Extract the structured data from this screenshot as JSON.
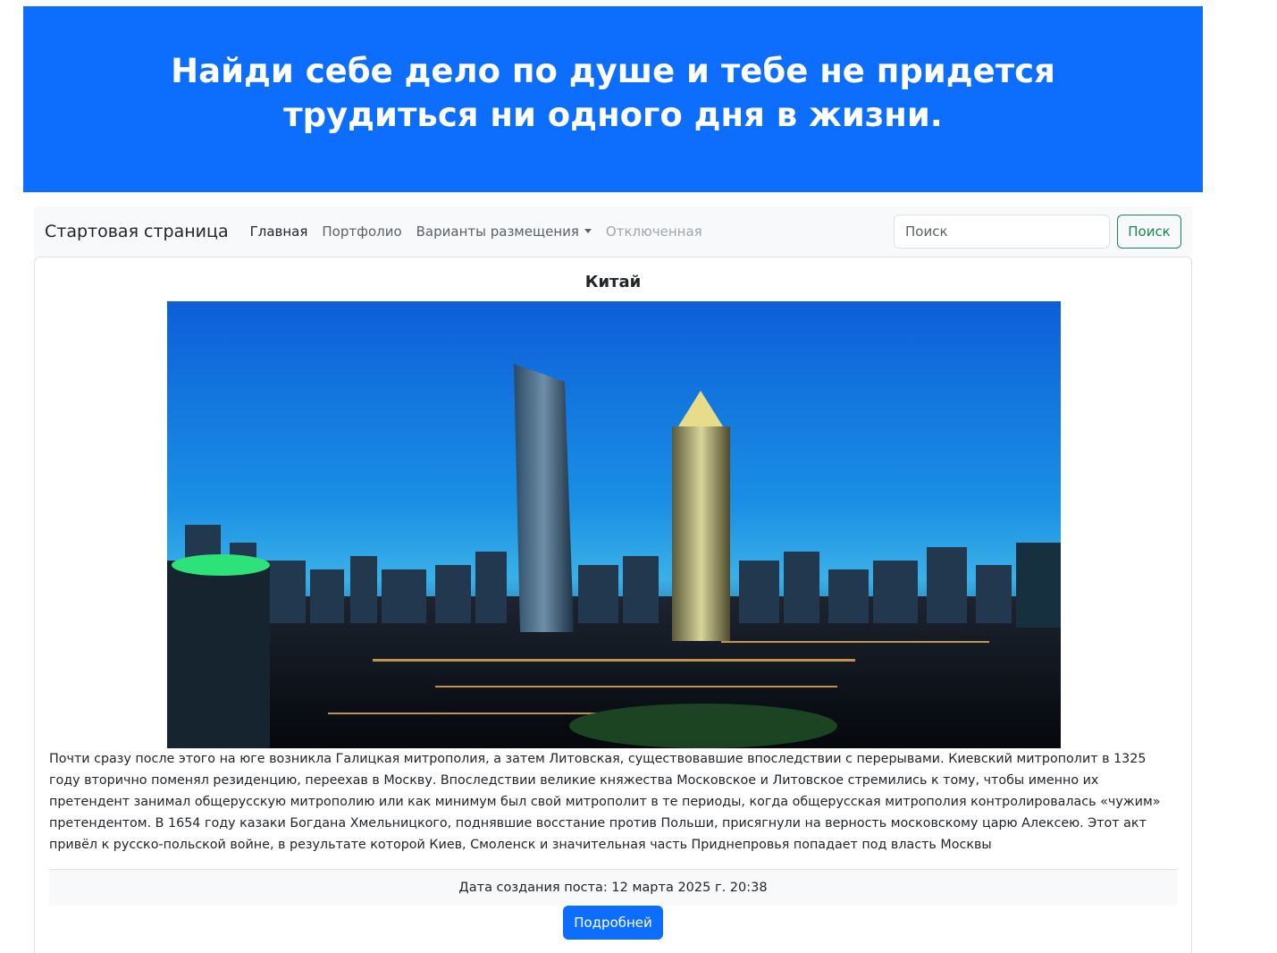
{
  "banner": {
    "title": "Найди себе дело по душе и тебе не придется трудиться ни одного дня в жизни."
  },
  "navbar": {
    "brand": "Стартовая страница",
    "links": [
      {
        "label": "Главная",
        "state": "active"
      },
      {
        "label": "Портфолио",
        "state": "normal"
      },
      {
        "label": "Варианты размещения",
        "state": "dropdown"
      },
      {
        "label": "Отключенная",
        "state": "disabled"
      }
    ],
    "search_placeholder": "Поиск",
    "search_button": "Поиск"
  },
  "post": {
    "title": "Китай",
    "image_alt": "Китай",
    "text": "Почти сразу после этого на юге возникла Галицкая митрополия, а затем Литовская, существовавшие впоследствии с перерывами. Киевский митрополит в 1325 году вторично поменял резиденцию, переехав в Москву. Впоследствии великие княжества Московское и Литовское стремились к тому, чтобы именно их претендент занимал общерусскую митрополию или как минимум был свой митрополит в те периоды, когда общерусская митрополия контролировалась «чужим» претендентом. В 1654 году казаки Богдана Хмельницкого, поднявшие восстание против Польши, присягнули на верность московскому царю Алексею. Этот акт привёл к русско-польской войне, в результате которой Киев, Смоленск и значительная часть Приднепровья попадает под власть Москвы",
    "footer": "Дата создания поста: 12 марта 2025 г. 20:38",
    "more_button": "Подробней"
  },
  "colors": {
    "primary": "#0d6efd",
    "success": "#198754",
    "navbar_bg": "#f8f9fa"
  }
}
